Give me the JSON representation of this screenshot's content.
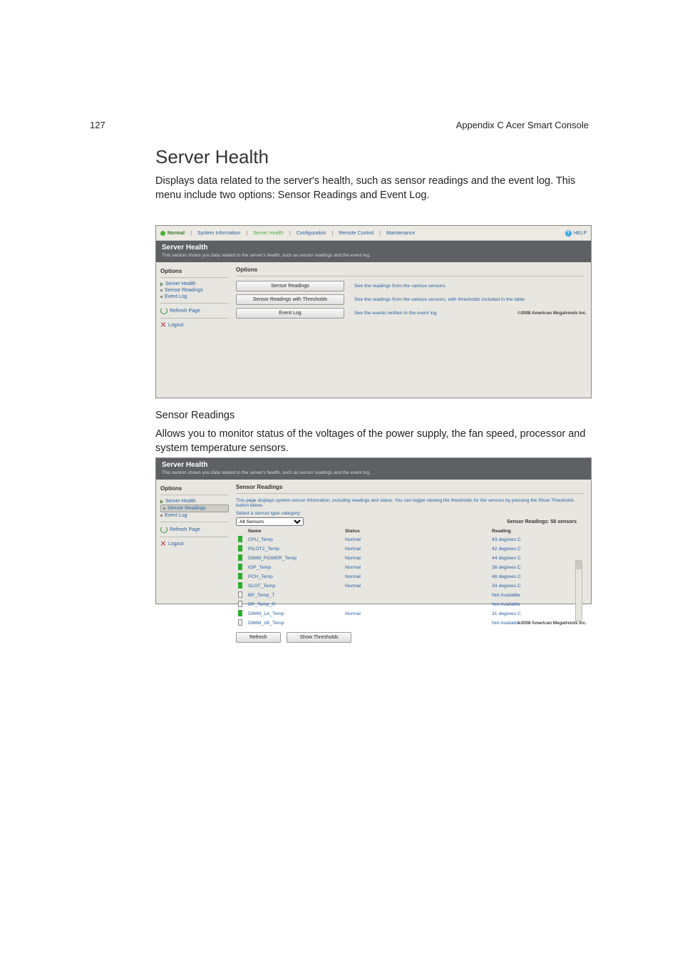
{
  "page_header": {
    "page_number": "127",
    "appendix": "Appendix C Acer Smart Console"
  },
  "heading": "Server Health",
  "paragraph1": "Displays data related to the server's health, such as sensor readings and the event log. This menu include two options: Sensor Readings and Event Log.",
  "subheading": "Sensor Readings",
  "paragraph2": "Allows you to monitor status of the voltages of the power supply, the fan speed, processor and system temperature sensors.",
  "nav": {
    "status": "Normal",
    "items": [
      "System Information",
      "Server Health",
      "Configuration",
      "Remote Control",
      "Maintenance"
    ],
    "active": "Server Health",
    "help": "HELP"
  },
  "banner": {
    "title": "Server Health",
    "desc": "This section shows you data related to the server's health, such as sensor readings and the event log."
  },
  "sidebar": {
    "title": "Options",
    "group": "Server Health",
    "items": [
      "Sensor Readings",
      "Event Log"
    ],
    "refresh": "Refresh Page",
    "logout": "Logout"
  },
  "shot1": {
    "section_title": "Options",
    "rows": [
      {
        "btn": "Sensor Readings",
        "txt": "See the readings from the various sensors"
      },
      {
        "btn": "Sensor Readings with Thresholds",
        "txt": "See the readings from the various sensors, with thresholds included in the table"
      },
      {
        "btn": "Event Log",
        "txt": "See the events written to the event log"
      }
    ],
    "footer": "©2008 American Megatrends Inc."
  },
  "shot2": {
    "section_title": "Sensor Readings",
    "section_desc": "This page displays system sensor information, including readings and status. You can toggle viewing the thresholds for the sensors by pressing the Show Thresholds button below.",
    "filter_label": "Select a sensor type category:",
    "filter_value": "All Sensors",
    "count_label": "Sensor Readings: 58 sensors",
    "columns": [
      "Name",
      "Status",
      "Reading"
    ],
    "rows": [
      {
        "c": "g",
        "name": "CPU_Temp",
        "status": "Normal",
        "reading": "43 degrees C"
      },
      {
        "c": "g",
        "name": "PILOT2_Temp",
        "status": "Normal",
        "reading": "42 degrees C"
      },
      {
        "c": "g",
        "name": "DIMM_POWER_Temp",
        "status": "Normal",
        "reading": "44 degrees C"
      },
      {
        "c": "g",
        "name": "IOP_Temp",
        "status": "Normal",
        "reading": "38 degrees C"
      },
      {
        "c": "g",
        "name": "PCH_Temp",
        "status": "Normal",
        "reading": "48 degrees C"
      },
      {
        "c": "g",
        "name": "SLOT_Temp",
        "status": "Normal",
        "reading": "34 degrees C"
      },
      {
        "c": "b",
        "name": "BP_Temp_T",
        "status": "",
        "reading": "Not Available"
      },
      {
        "c": "b",
        "name": "BP_Temp_R",
        "status": "",
        "reading": "Not Available"
      },
      {
        "c": "g",
        "name": "DIMM_1A_Temp",
        "status": "Normal",
        "reading": "31 degrees C"
      },
      {
        "c": "b",
        "name": "DIMM_1B_Temp",
        "status": "",
        "reading": "Not Available"
      }
    ],
    "btn_refresh": "Refresh",
    "btn_thresh": "Show Thresholds",
    "footer": "©2008 American Megatrends Inc."
  }
}
